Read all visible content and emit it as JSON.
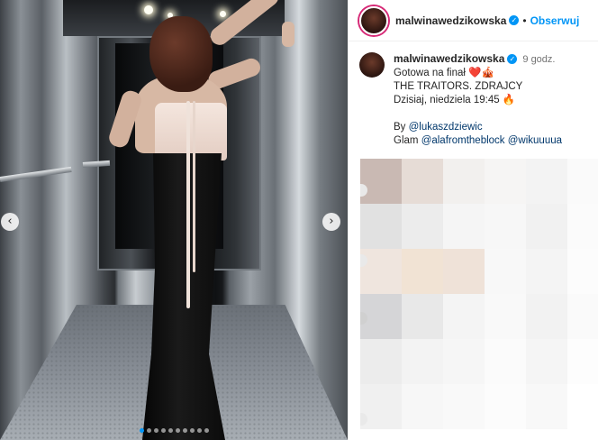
{
  "post": {
    "username": "malwinawedzikowska",
    "follow_label": "Obserwuj",
    "bullet": "•",
    "time": "9 godz.",
    "caption": {
      "line1": "Gotowa na finał",
      "line1_emoji": "❤️🎪",
      "line2": "THE TRAITORS. ZDRAJCY",
      "line3": "Dzisiaj, niedziela 19:45",
      "line3_emoji": "🔥",
      "by_label": "By",
      "by_handle": "@lukaszdziewic",
      "glam_label": "Glam",
      "glam_handle1": "@alafromtheblock",
      "glam_handle2": "@wikuuuua"
    }
  },
  "carousel": {
    "prev_icon": "‹",
    "next_icon": "›",
    "slide_count": 10,
    "active_index": 0
  },
  "colors": {
    "accent": "#0095f6",
    "verified": "#0095f6",
    "heart": "#ed4956",
    "link": "#00376b"
  }
}
